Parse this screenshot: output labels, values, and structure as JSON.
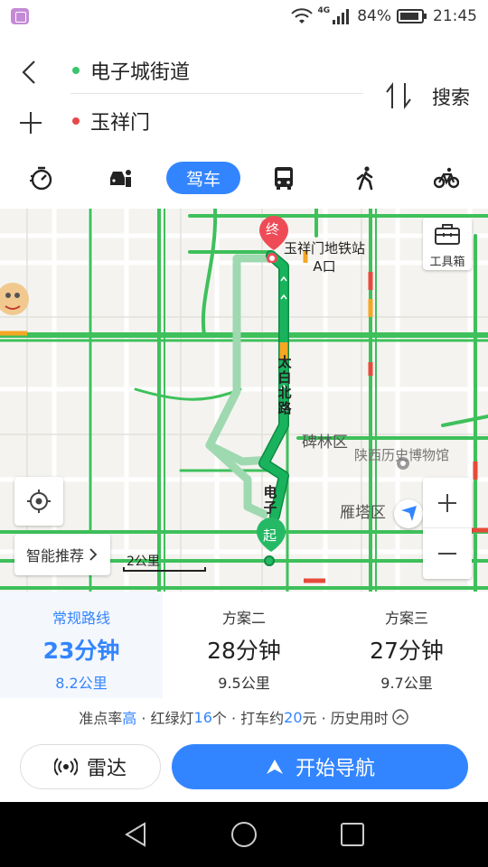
{
  "status": {
    "network": "4G",
    "battery": "84%",
    "time": "21:45"
  },
  "header": {
    "start": "电子城街道",
    "end": "玉祥门",
    "search_label": "搜索"
  },
  "modes": {
    "active_label": "驾车",
    "icons": [
      "stopwatch-icon",
      "ride-hailing-icon",
      "car",
      "bus-icon",
      "walk-icon",
      "bike-icon"
    ]
  },
  "map": {
    "toolbox_label": "工具箱",
    "end_pin_label": "终",
    "start_pin_label": "起",
    "end_poi": "玉祥门地铁站\nA口",
    "road_taibai": "太白北路",
    "road_dianzi": "电子",
    "district_beilin": "碑林区",
    "district_yanta": "雁塔区",
    "poi_museum": "陕西历史博物馆",
    "smart_recommend": "智能推荐",
    "scale_label": "2公里",
    "colors": {
      "traffic_green": "#3ec05b",
      "route_main": "#19b35d",
      "route_alt": "#9ed9b0",
      "congestion": "#f5a623",
      "heavy": "#e64a3b"
    }
  },
  "routes": [
    {
      "name": "常规路线",
      "time": "23分钟",
      "distance": "8.2公里",
      "selected": true
    },
    {
      "name": "方案二",
      "time": "28分钟",
      "distance": "9.5公里",
      "selected": false
    },
    {
      "name": "方案三",
      "time": "27分钟",
      "distance": "9.7公里",
      "selected": false
    }
  ],
  "info": {
    "punctuality_prefix": "准点率",
    "punctuality_value": "高",
    "lights_prefix": " · 红绿灯",
    "lights_value": "16",
    "lights_suffix": "个 · 打车约",
    "taxi_value": "20",
    "taxi_suffix": "元 · 历史用时"
  },
  "actions": {
    "radar_label": "雷达",
    "navigate_label": "开始导航"
  },
  "brand": {
    "accent": "#3385ff"
  }
}
